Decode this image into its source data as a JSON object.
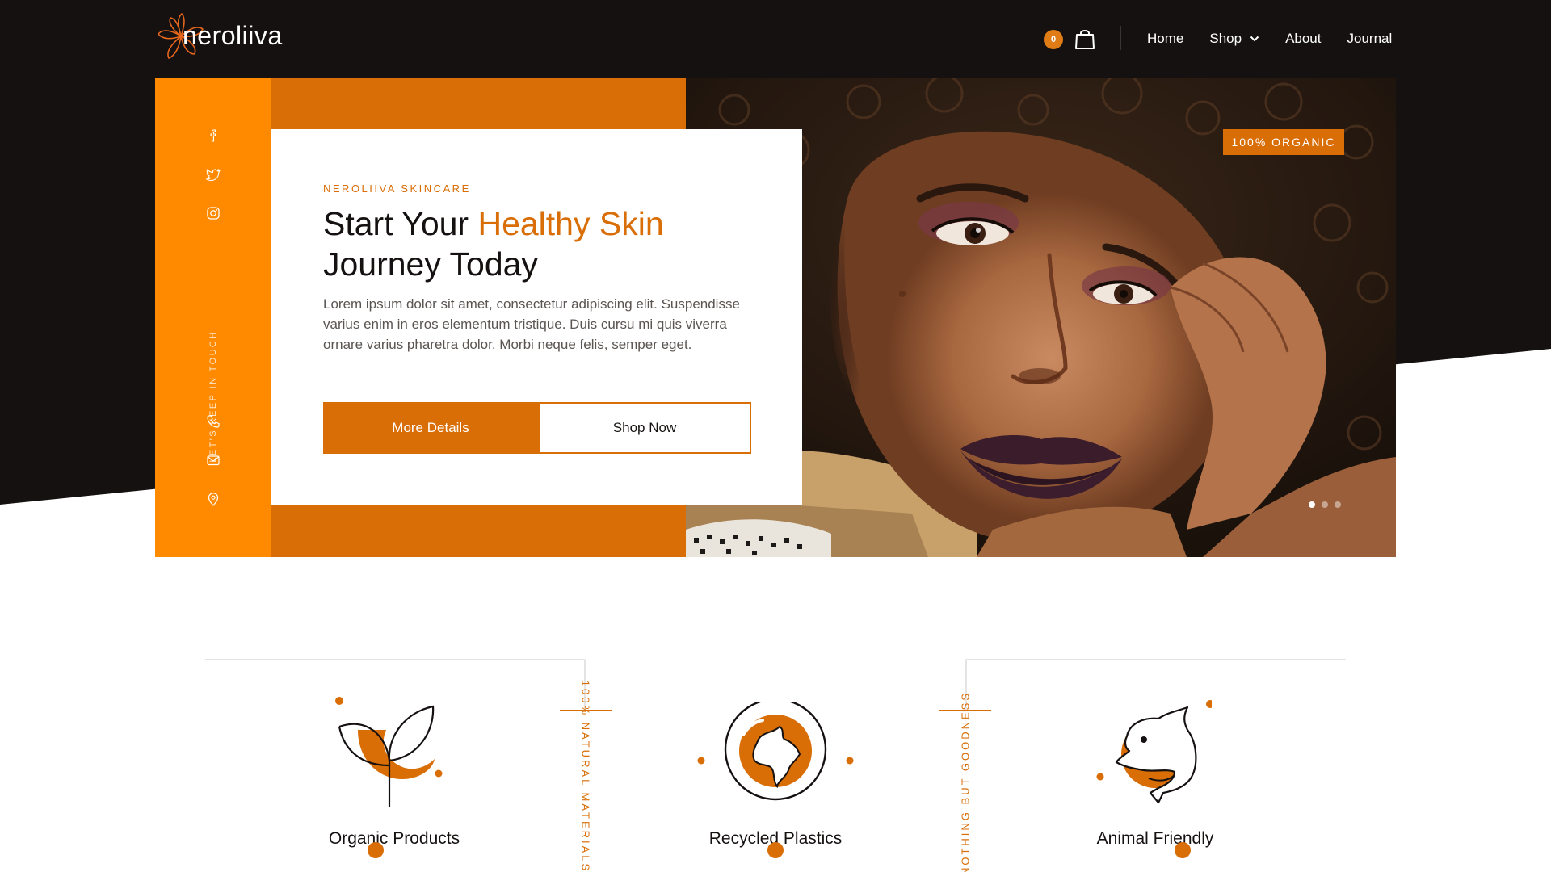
{
  "brand": {
    "name": "neroliiva"
  },
  "colors": {
    "accent": "#d96d06",
    "accent_bright": "#ff8a00",
    "dark": "#151110"
  },
  "header": {
    "cart_count": "0",
    "nav": [
      {
        "label": "Home"
      },
      {
        "label": "Shop",
        "has_dropdown": true
      },
      {
        "label": "About"
      },
      {
        "label": "Journal"
      }
    ]
  },
  "social": {
    "icons": [
      "facebook-icon",
      "twitter-icon",
      "instagram-icon",
      "phone-icon",
      "mail-icon",
      "location-icon"
    ],
    "touch_label": "LET'S KEEP IN TOUCH"
  },
  "hero": {
    "eyebrow": "NEROLIIVA SKINCARE",
    "headline_start": "Start Your ",
    "headline_accent": "Healthy Skin",
    "headline_end": "Journey Today",
    "body": "Lorem ipsum dolor sit amet, consectetur adipiscing elit. Suspendisse varius enim in eros elementum tristique. Duis cursu mi quis viverra ornare varius pharetra dolor. Morbi neque felis, semper eget.",
    "primary_button": "More Details",
    "secondary_button": "Shop Now",
    "badge": "100% ORGANIC",
    "slide_count": 3,
    "active_slide": 1
  },
  "features": {
    "items": [
      {
        "title": "Organic Products",
        "icon": "leaf-icon"
      },
      {
        "title": "Recycled Plastics",
        "icon": "globe-icon"
      },
      {
        "title": "Animal Friendly",
        "icon": "dolphin-icon"
      }
    ],
    "vertical_text_1": "100% NATURAL MATERIALS",
    "vertical_text_2": "NOTHING BUT GOODNESS"
  }
}
